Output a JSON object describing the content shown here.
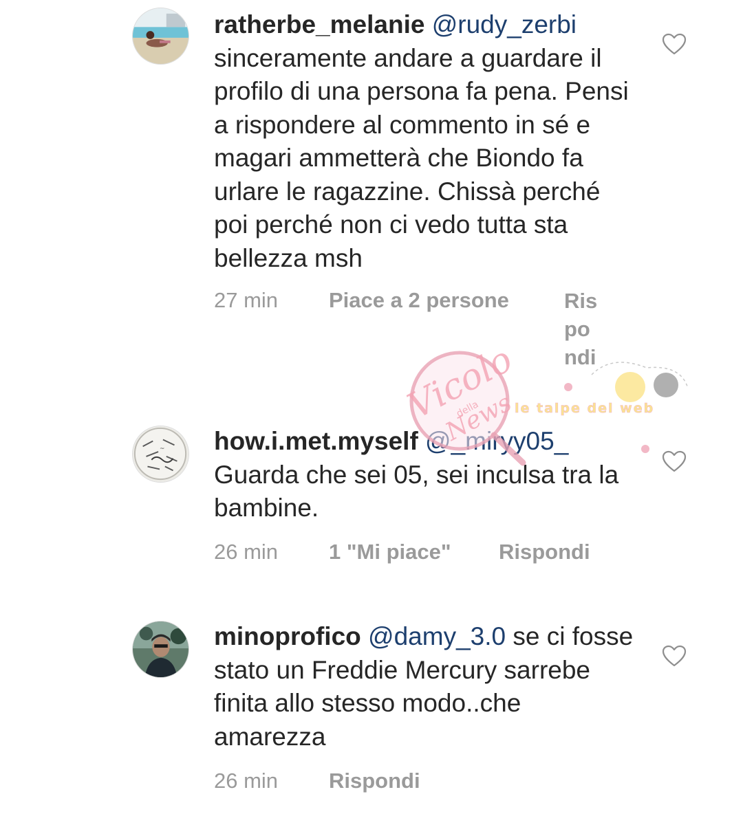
{
  "comments": [
    {
      "username": "ratherbe_melanie",
      "mention": "@rudy_zerbi",
      "body": "sinceramente andare a guardare il profilo di una persona fa pena. Pensi a rispondere al commento in sé e magari ammetterà che Biondo fa urlare le ragazzine. Chissà perché poi perché non ci vedo tutta sta bellezza msh",
      "time": "27 min",
      "likes": "Piace a 2 persone",
      "reply_lines": [
        "Ris",
        "po",
        "ndi"
      ],
      "avatar_icon": "beach-photo-avatar"
    },
    {
      "username": "how.i.met.myself",
      "mention": "@_miryy05_",
      "body": "Guarda che sei 05, sei inculsa tra la bambine.",
      "time": "26 min",
      "likes": "1 \"Mi piace\"",
      "reply": "Rispondi",
      "avatar_icon": "sketch-avatar"
    },
    {
      "username": "minoprofico",
      "mention": "@damy_3.0",
      "body": "se ci fosse stato un Freddie Mercury sarrebe finita allo stesso modo..che amarezza",
      "time": "26 min",
      "reply": "Rispondi",
      "avatar_icon": "person-photo-avatar"
    }
  ],
  "watermark": {
    "logo_main": "Vicolo",
    "logo_small": "della",
    "logo_tail": "News",
    "tagline": "le talpe del web"
  },
  "colors": {
    "mention": "#1d3f6e",
    "meta": "#9a9a9a",
    "text": "#262626"
  }
}
